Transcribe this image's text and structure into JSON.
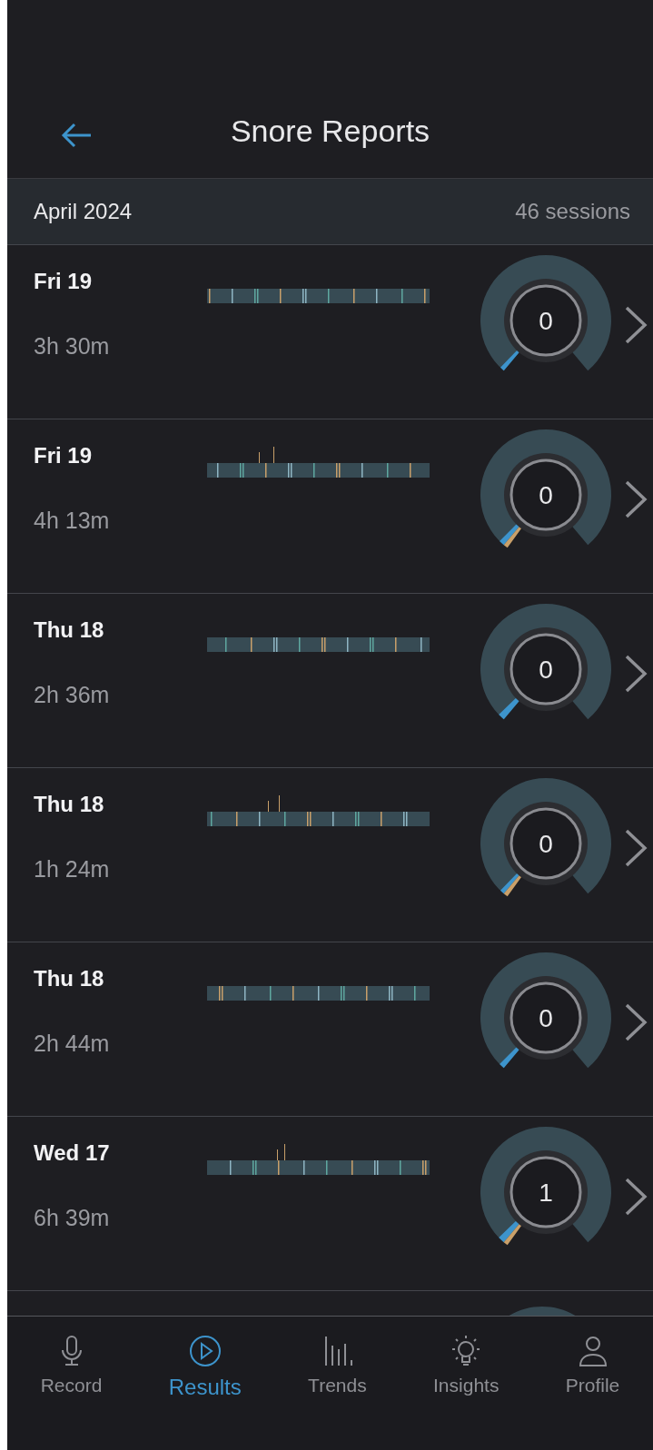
{
  "header": {
    "title": "Snore Reports"
  },
  "month": {
    "label": "April 2024",
    "count": "46 sessions"
  },
  "sessions": [
    {
      "kind": "full",
      "day": "Fri 19",
      "duration": "3h 30m",
      "score": "0"
    },
    {
      "kind": "full",
      "day": "Fri 19",
      "duration": "4h 13m",
      "score": "0"
    },
    {
      "kind": "full",
      "day": "Thu 18",
      "duration": "2h 36m",
      "score": "0"
    },
    {
      "kind": "full",
      "day": "Thu 18",
      "duration": "1h 24m",
      "score": "0"
    },
    {
      "kind": "full",
      "day": "Thu 18",
      "duration": "2h 44m",
      "score": "0"
    },
    {
      "kind": "full",
      "day": "Wed 17",
      "duration": "6h 39m",
      "score": "1"
    },
    {
      "kind": "partial"
    }
  ],
  "nav": [
    {
      "label": "Record",
      "selected": false
    },
    {
      "label": "Results",
      "selected": true
    },
    {
      "label": "Trends",
      "selected": false
    },
    {
      "label": "Insights",
      "selected": false
    },
    {
      "label": "Profile",
      "selected": false
    }
  ]
}
